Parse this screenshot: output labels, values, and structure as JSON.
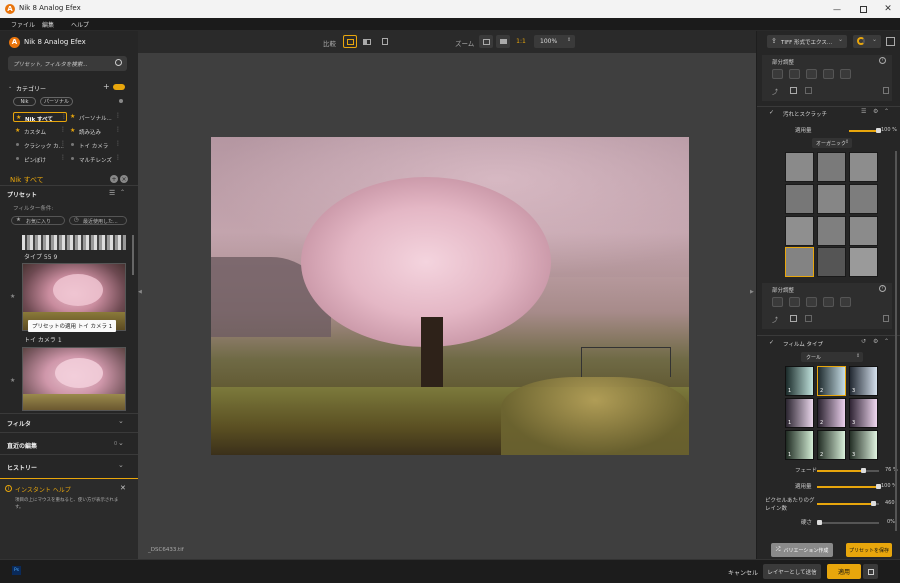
{
  "window": {
    "title": "Nik 8 Analog Efex"
  },
  "menu": [
    "ファイル",
    "編集",
    "ヘルプ"
  ],
  "logo": "Nik 8 Analog Efex",
  "search": {
    "placeholder": "プリセット, フィルタを検索..."
  },
  "category": {
    "title": "カテゴリー",
    "tabs": [
      "Nik",
      "パーソナル"
    ],
    "items": [
      {
        "label": "Nik すべて",
        "icon": "star"
      },
      {
        "label": "パーソナル...",
        "icon": "star"
      },
      {
        "label": "カスタム",
        "icon": "star"
      },
      {
        "label": "読み込み",
        "icon": "star"
      },
      {
        "label": "クラシック カ...",
        "icon": "dot"
      },
      {
        "label": "トイ カメラ",
        "icon": "dot"
      },
      {
        "label": "ピンぼけ",
        "icon": "dot"
      },
      {
        "label": "マルチレンズ",
        "icon": "dot"
      }
    ]
  },
  "nik_all_label": "Nik すべて",
  "presets": {
    "title": "プリセット",
    "filter_label": "フィルター条件:",
    "favorites": "お気に入り",
    "recent": "最近使用した...",
    "items": [
      {
        "label": "タイプ 55 9"
      },
      {
        "label": "トイ カメラ 1"
      }
    ],
    "tooltip": "プリセットの適用 トイ カメラ 1"
  },
  "sections": {
    "filter": "フィルタ",
    "recent_edits": "直近の編集",
    "recent_edits_count": "0",
    "history": "ヒストリー"
  },
  "instant_help": {
    "title": "インスタント ヘルプ",
    "text": "項目の上にマウスを重ねると、使い方が表示されます。"
  },
  "toolbar": {
    "compare": "比較",
    "zoom": "ズーム",
    "zoom_1to1": "1:1",
    "zoom_value": "100%"
  },
  "filename": "_DSC6433.tif",
  "right": {
    "export_label": "TIFF 形式でエクス...",
    "partial_adjust": "部分調整",
    "dirt": {
      "title": "汚れとスクラッチ",
      "amount_label": "適用量",
      "amount_value": "100 %",
      "amount": 1.0,
      "dropdown": "オーガニック"
    },
    "film": {
      "title": "フィルム タイプ",
      "dropdown": "クール",
      "fade_label": "フェード",
      "fade_value": "76 %",
      "fade": 0.76,
      "amount_label": "適用量",
      "amount_value": "100 %",
      "amount": 1.0,
      "grain_label": "ピクセルあたりのグレイン数",
      "grain_value": "460",
      "grain": 0.92,
      "hardness_label": "硬さ",
      "hardness_value": "0%",
      "hardness": 0.0,
      "numbers": [
        "1",
        "2",
        "3",
        "1",
        "2",
        "3",
        "1",
        "2",
        "3"
      ]
    },
    "variation_button": "バリエーション作成",
    "save_preset_button": "プリセットを保存"
  },
  "bottom": {
    "cancel": "キャンセル",
    "send_layer": "レイヤーとして送信",
    "apply": "適用",
    "ps": "Ps"
  },
  "colors": {
    "accent": "#e8a60c"
  }
}
